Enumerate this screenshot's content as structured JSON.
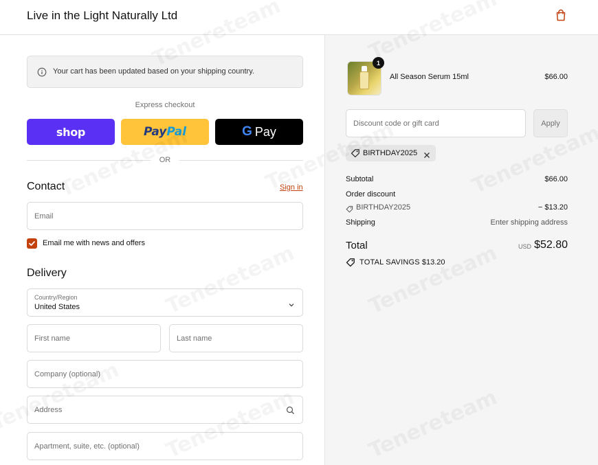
{
  "header": {
    "store_name": "Live in the Light Naturally Ltd",
    "cart_icon": "shopping-bag-icon"
  },
  "notice": {
    "icon": "info-icon",
    "text": "Your cart has been updated based on your shipping country."
  },
  "express": {
    "label": "Express checkout",
    "shop_label": "shop",
    "paypal_label_1": "Pay",
    "paypal_label_2": "Pal",
    "gpay_g": "G",
    "gpay_label": "Pay",
    "or_label": "OR"
  },
  "contact": {
    "title": "Contact",
    "sign_in": "Sign in",
    "email_placeholder": "Email",
    "newsletter_label": "Email me with news and offers",
    "newsletter_checked": true
  },
  "delivery": {
    "title": "Delivery",
    "country_label": "Country/Region",
    "country_value": "United States",
    "first_name_placeholder": "First name",
    "last_name_placeholder": "Last name",
    "company_placeholder": "Company (optional)",
    "address_placeholder": "Address",
    "apartment_placeholder": "Apartment, suite, etc. (optional)"
  },
  "order": {
    "product_name": "All Season Serum 15ml",
    "product_price": "$66.00",
    "quantity": "1",
    "discount_placeholder": "Discount code or gift card",
    "apply_label": "Apply",
    "applied_code": "BIRTHDAY2025",
    "subtotal_label": "Subtotal",
    "subtotal_value": "$66.00",
    "order_discount_label": "Order discount",
    "discount_code": "BIRTHDAY2025",
    "discount_value": "− $13.20",
    "shipping_label": "Shipping",
    "shipping_value": "Enter shipping address",
    "total_label": "Total",
    "total_currency": "USD",
    "total_value": "$52.80",
    "savings_label": "TOTAL SAVINGS",
    "savings_value": "$13.20"
  },
  "colors": {
    "accent": "#c2410c",
    "shop_pay": "#5a31f4",
    "paypal": "#ffc439",
    "gpay": "#000000"
  },
  "watermark": "Tenereteam"
}
